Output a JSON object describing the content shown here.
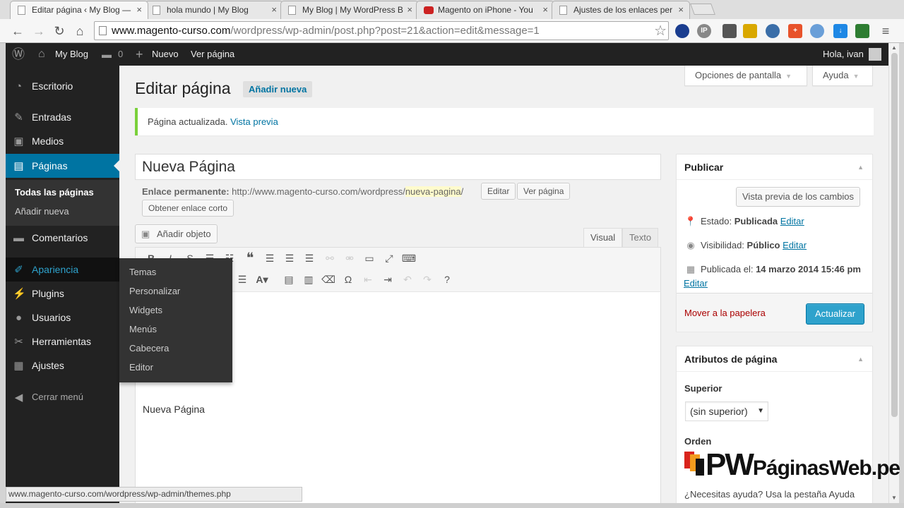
{
  "browser": {
    "tabs": [
      {
        "label": "Editar página ‹ My Blog —",
        "active": true,
        "icon": "page-icon"
      },
      {
        "label": "hola mundo | My Blog",
        "active": false,
        "icon": "page-icon"
      },
      {
        "label": "My Blog | My WordPress B",
        "active": false,
        "icon": "page-icon"
      },
      {
        "label": "Magento on iPhone - You",
        "active": false,
        "icon": "youtube-icon"
      },
      {
        "label": "Ajustes de los enlaces per",
        "active": false,
        "icon": "page-icon"
      }
    ],
    "close_glyph": "×",
    "url_host": "www.magento-curso.com",
    "url_path": "/wordpress/wp-admin/post.php?post=21&action=edit&message=1",
    "status_url": "www.magento-curso.com/wordpress/wp-admin/themes.php",
    "ext_labels": [
      "IP"
    ]
  },
  "adminbar": {
    "site_name": "My Blog",
    "comments_count": "0",
    "new_label": "Nuevo",
    "view_label": "Ver página",
    "greeting": "Hola, ivan"
  },
  "sidebar": {
    "items": [
      {
        "label": "Escritorio",
        "icon": "dashboard-icon",
        "glyph": "◔"
      },
      {
        "label": "Entradas",
        "icon": "pin-icon",
        "glyph": "✎"
      },
      {
        "label": "Medios",
        "icon": "media-icon",
        "glyph": "▣"
      },
      {
        "label": "Páginas",
        "icon": "pages-icon",
        "glyph": "▤"
      },
      {
        "label": "Comentarios",
        "icon": "comment-icon",
        "glyph": "▬"
      },
      {
        "label": "Apariencia",
        "icon": "brush-icon",
        "glyph": "✐"
      },
      {
        "label": "Plugins",
        "icon": "plug-icon",
        "glyph": "⚡"
      },
      {
        "label": "Usuarios",
        "icon": "user-icon",
        "glyph": "●"
      },
      {
        "label": "Herramientas",
        "icon": "wrench-icon",
        "glyph": "✂"
      },
      {
        "label": "Ajustes",
        "icon": "settings-icon",
        "glyph": "▦"
      }
    ],
    "submenu": [
      "Todas las páginas",
      "Añadir nueva"
    ],
    "collapse_label": "Cerrar menú",
    "flyout": [
      "Temas",
      "Personalizar",
      "Widgets",
      "Menús",
      "Cabecera",
      "Editor"
    ]
  },
  "header": {
    "screen_options": "Opciones de pantalla",
    "help": "Ayuda",
    "title": "Editar página",
    "add_new": "Añadir nueva"
  },
  "notice": {
    "text": "Página actualizada.",
    "link": "Vista previa"
  },
  "editor": {
    "post_title": "Nueva Página",
    "permalink_label": "Enlace permanente:",
    "permalink_base": "http://www.magento-curso.com/wordpress/",
    "permalink_slug": "nueva-pagina",
    "permalink_trail": "/",
    "edit_btn": "Editar",
    "view_btn": "Ver página",
    "shortlink_btn": "Obtener enlace corto",
    "add_media": "Añadir objeto",
    "tab_visual": "Visual",
    "tab_text": "Texto",
    "body_text": "Nueva Página"
  },
  "publish": {
    "title": "Publicar",
    "preview_btn": "Vista previa de los cambios",
    "status_label": "Estado:",
    "status_value": "Publicada",
    "visibility_label": "Visibilidad:",
    "visibility_value": "Público",
    "edit_link": "Editar",
    "published_label": "Publicada el:",
    "published_value": "14 marzo 2014 15:46 pm",
    "trash": "Mover a la papelera",
    "update_btn": "Actualizar"
  },
  "attributes": {
    "title": "Atributos de página",
    "parent_label": "Superior",
    "parent_value": "(sin superior)",
    "order_label": "Orden",
    "help_text": "¿Necesitas ayuda? Usa la pestaña Ayuda"
  },
  "watermark": {
    "brand_pw": "PW",
    "brand_name": "Páginas",
    "brand_web": "Web.pe"
  },
  "colors": {
    "accent": "#0074a2",
    "button": "#2ea2cc",
    "admin_dark": "#222222",
    "notice_green": "#7ad03a",
    "trash_red": "#aa0000"
  }
}
